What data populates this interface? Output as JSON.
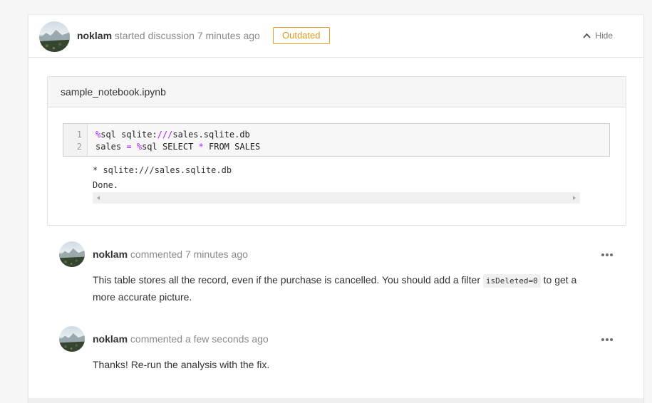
{
  "discussion": {
    "author": "noklam",
    "action": "started discussion",
    "time": "7 minutes ago",
    "badge": "Outdated",
    "hide_label": "Hide"
  },
  "file": {
    "name": "sample_notebook.ipynb",
    "line_numbers": [
      "1",
      "2"
    ],
    "code": {
      "line1_magic": "%",
      "line1_text": "sql sqlite:",
      "line1_slashes": "///",
      "line1_rest": "sales.sqlite.db",
      "line2_start": "sales ",
      "line2_eq": "=",
      "line2_space": " ",
      "line2_magic": "%",
      "line2_mid": "sql SELECT ",
      "line2_star": "*",
      "line2_end": " FROM SALES"
    },
    "output": [
      "* sqlite:///sales.sqlite.db",
      "Done."
    ]
  },
  "comments": [
    {
      "author": "noklam",
      "action": "commented",
      "time": "7 minutes ago",
      "text_before": "This table stores all the record, even if the purchase is cancelled. You should add a filter ",
      "code": "isDeleted=0",
      "text_after": " to get a more accurate picture."
    },
    {
      "author": "noklam",
      "action": "commented",
      "time": "a few seconds ago",
      "text": "Thanks! Re-run the analysis with the fix."
    }
  ],
  "icons": {
    "hide": "chevron-up-icon",
    "more": "more-horizontal-icon",
    "scroll_left": "caret-left-icon",
    "scroll_right": "caret-right-icon"
  },
  "colors": {
    "badge": "#d99a1c",
    "magic_keyword": "#aa22ff",
    "muted_text": "#8a8a8a"
  }
}
